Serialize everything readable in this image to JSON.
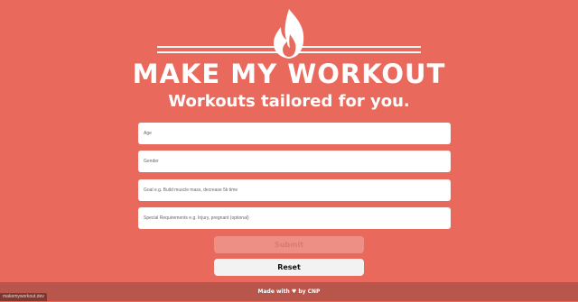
{
  "header": {
    "logo_icon": "flame-icon",
    "title": "MAKE MY WORKOUT",
    "tagline": "Workouts tailored for you."
  },
  "form": {
    "age_placeholder": "Age",
    "gender_placeholder": "Gender",
    "goal_placeholder": "Goal e.g. Build muscle mass, decrease 5k time",
    "special_placeholder": "Special Requirements e.g. Injury, pregnant (optional)",
    "submit_label": "Submit",
    "reset_label": "Reset"
  },
  "footer": {
    "made_with": "Made with",
    "heart_icon": "heart-icon",
    "heart_glyph": "♥",
    "by": "by CNP"
  },
  "status_bar": {
    "url": "makemyworkout.dev"
  },
  "colors": {
    "background": "#e96a5d",
    "footer": "#b9564b",
    "submit_disabled": "#ee8f85",
    "reset": "#f2f2f2"
  }
}
